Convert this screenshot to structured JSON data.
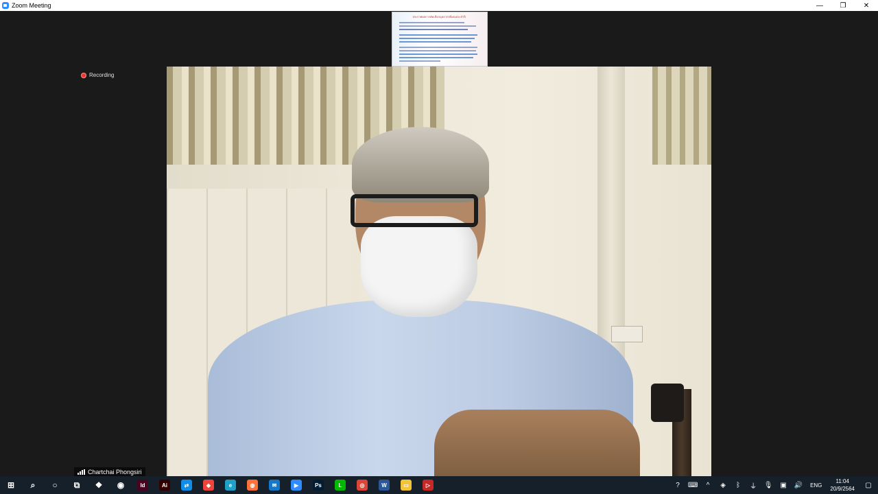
{
  "window": {
    "title": "Zoom Meeting",
    "minimize": "—",
    "restore": "❐",
    "close": "✕"
  },
  "recording": {
    "label": "Recording"
  },
  "shared_thumbnail": {
    "heading": "ประกาศผลการคัดเลือกบุคลากรดีเด่นประจำปี"
  },
  "participant": {
    "name": "Chartchai Phongsiri"
  },
  "taskbar": {
    "apps": [
      {
        "name": "start-button",
        "label": "⊞",
        "bg": "transparent"
      },
      {
        "name": "search-icon",
        "label": "⌕",
        "bg": "transparent"
      },
      {
        "name": "cortana-icon",
        "label": "○",
        "bg": "transparent"
      },
      {
        "name": "task-view-icon",
        "label": "⧉",
        "bg": "transparent"
      },
      {
        "name": "dropbox-icon",
        "label": "❖",
        "bg": "transparent"
      },
      {
        "name": "app-circle-icon",
        "label": "◉",
        "bg": "transparent"
      },
      {
        "name": "indesign-icon",
        "label": "Id",
        "bg": "#49021f"
      },
      {
        "name": "illustrator-icon",
        "label": "Ai",
        "bg": "#330000"
      },
      {
        "name": "teamviewer-icon",
        "label": "⇄",
        "bg": "#0e8ee9"
      },
      {
        "name": "anydesk-icon",
        "label": "◆",
        "bg": "#ef443b"
      },
      {
        "name": "edge-icon",
        "label": "e",
        "bg": "#1fa1c7"
      },
      {
        "name": "firefox-icon",
        "label": "◍",
        "bg": "#ff7139"
      },
      {
        "name": "mail-icon",
        "label": "✉",
        "bg": "#1577c7"
      },
      {
        "name": "zoom-icon",
        "label": "▶",
        "bg": "#2d8cff"
      },
      {
        "name": "photoshop-icon",
        "label": "Ps",
        "bg": "#001d34"
      },
      {
        "name": "line-icon",
        "label": "L",
        "bg": "#00b900"
      },
      {
        "name": "chrome-icon",
        "label": "◎",
        "bg": "#db4437"
      },
      {
        "name": "word-icon",
        "label": "W",
        "bg": "#2b579a"
      },
      {
        "name": "file-explorer-icon",
        "label": "▭",
        "bg": "#f3c338"
      },
      {
        "name": "video-player-icon",
        "label": "▷",
        "bg": "#c62828"
      }
    ],
    "tray": [
      {
        "name": "help-icon",
        "label": "?"
      },
      {
        "name": "keyboard-icon",
        "label": "⌨"
      },
      {
        "name": "chevron-up-icon",
        "label": "^"
      },
      {
        "name": "tray-app-icon",
        "label": "◈"
      },
      {
        "name": "bluetooth-icon",
        "label": "ᛒ"
      },
      {
        "name": "usb-icon",
        "label": "⏚"
      },
      {
        "name": "microphone-icon",
        "label": "🎙"
      },
      {
        "name": "network-icon",
        "label": "▣"
      },
      {
        "name": "volume-icon",
        "label": "🔊"
      }
    ],
    "language": "ENG",
    "time": "11:04",
    "date": "20/9/2564",
    "notifications": "▢"
  }
}
